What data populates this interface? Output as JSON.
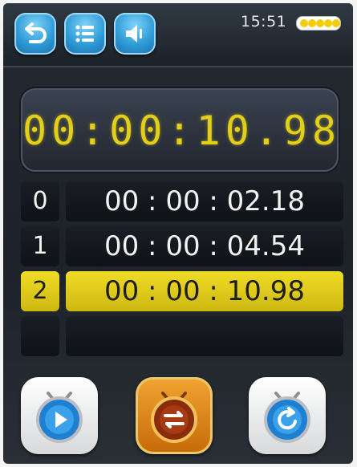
{
  "status": {
    "time": "15:51",
    "battery_level": 4,
    "battery_max": 5
  },
  "toolbar": {
    "back_icon": "back-arrow-icon",
    "menu_icon": "list-icon",
    "volume_icon": "speaker-icon"
  },
  "timer": {
    "current": "00:00:10.98"
  },
  "laps": [
    {
      "index": "0",
      "time": "00 : 00 : 02.18",
      "active": false
    },
    {
      "index": "1",
      "time": "00 : 00 : 04.54",
      "active": false
    },
    {
      "index": "2",
      "time": "00 : 00 : 10.98",
      "active": true
    },
    {
      "index": "",
      "time": "",
      "active": false
    }
  ],
  "controls": {
    "start_icon": "stopwatch-play-icon",
    "lap_icon": "stopwatch-split-icon",
    "reset_icon": "stopwatch-reset-icon"
  },
  "colors": {
    "accent_yellow": "#e3cf1a",
    "button_blue": "#2e9ad7",
    "orange": "#e08a1a"
  }
}
